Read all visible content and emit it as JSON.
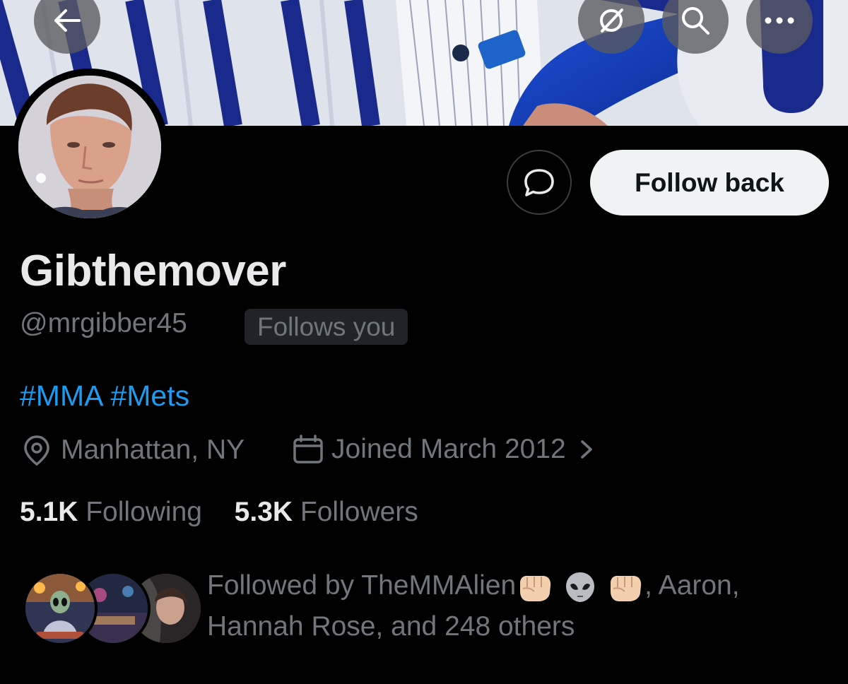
{
  "header": {
    "back_icon": "arrow-left-icon",
    "notify_icon": "notifications-off-icon",
    "search_icon": "search-icon",
    "more_icon": "more-dots-icon"
  },
  "profile": {
    "display_name": "Gibthemover",
    "handle": "@mrgibber45",
    "follows_you_label": "Follows you",
    "bio_tags": [
      "#MMA",
      "#Mets"
    ],
    "location": "Manhattan, NY",
    "joined": "Joined March 2012",
    "following_count": "5.1K",
    "following_label": "Following",
    "followers_count": "5.3K",
    "followers_label": "Followers"
  },
  "actions": {
    "message_icon": "message-bubble-icon",
    "follow_back_label": "Follow back"
  },
  "followed_by": {
    "prefix": "Followed by",
    "first_name": "TheMMAlien",
    "rest": ", Aaron, Hannah Rose, and 248 others"
  },
  "colors": {
    "background": "#000000",
    "text_primary": "#e7e9ea",
    "text_secondary": "#71767b",
    "link": "#1d9bf0",
    "follow_button": "#eff3f4"
  }
}
